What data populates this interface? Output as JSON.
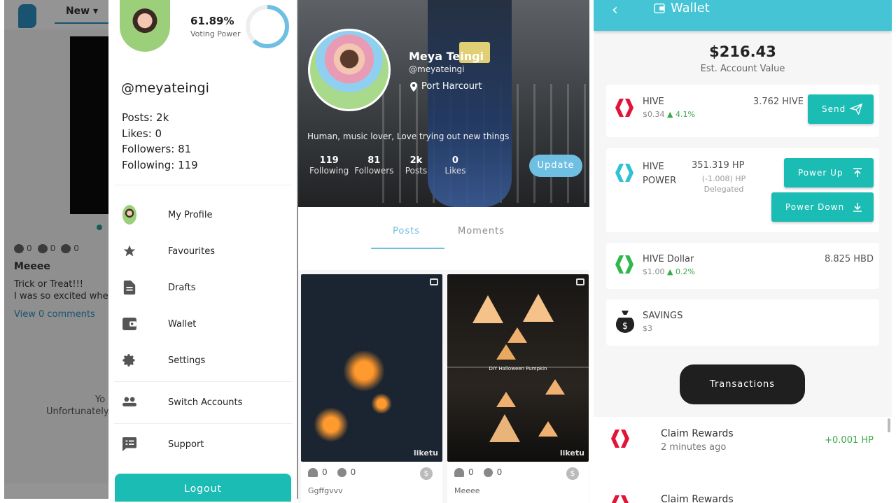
{
  "feed": {
    "tab_new": "New",
    "likes": "0",
    "comments": "0",
    "votes": "0",
    "post_title": "Meeee",
    "post_body_line1": "Trick or Treat!!!",
    "post_body_line2": "I was so excited whe",
    "view_comments": "View 0 comments",
    "empty_line1": "Yo",
    "empty_line2": "Unfortunately"
  },
  "drawer": {
    "voting_power_pct": "61.89%",
    "voting_power_value": 0.6189,
    "voting_power_label": "Voting Power",
    "handle": "@meyateingi",
    "posts": "Posts: 2k",
    "likes": "Likes: 0",
    "followers": "Followers: 81",
    "following": "Following: 119",
    "menu": {
      "my_profile": "My Profile",
      "favourites": "Favourites",
      "drafts": "Drafts",
      "wallet": "Wallet",
      "settings": "Settings",
      "switch_accounts": "Switch Accounts",
      "support": "Support"
    },
    "logout": "Logout"
  },
  "profile": {
    "name": "Meya Teingi",
    "handle": "@meyateingi",
    "location": "Port Harcourt",
    "bio": "Human, music lover, Love trying out new things",
    "stats": [
      {
        "n": "119",
        "l": "Following"
      },
      {
        "n": "81",
        "l": "Followers"
      },
      {
        "n": "2k",
        "l": "Posts"
      },
      {
        "n": "0",
        "l": "Likes"
      }
    ],
    "update_label": "Update",
    "tab_posts": "Posts",
    "tab_moments": "Moments",
    "posts": [
      {
        "title": "Ggffgvvv",
        "likes": "0",
        "comments": "0",
        "watermark": "liketu"
      },
      {
        "title": "Meeee",
        "likes": "0",
        "comments": "0",
        "caption": "DIY Halloween Pumpkin",
        "watermark": "liketu"
      }
    ]
  },
  "wallet": {
    "title": "Wallet",
    "total_value": "$216.43",
    "total_label": "Est. Account Value",
    "hive": {
      "name": "HIVE",
      "price": "$0.34",
      "change": "4.1%",
      "amount": "3.762 HIVE",
      "send": "Send"
    },
    "hive_power": {
      "name_line1": "HIVE",
      "name_line2": "POWER",
      "amount": "351.319 HP",
      "delegated_line1": "(-1.008) HP",
      "delegated_line2": "Delegated",
      "power_up": "Power Up",
      "power_down": "Power Down"
    },
    "hbd": {
      "name": "HIVE Dollar",
      "price": "$1.00",
      "change": "0.2%",
      "amount": "8.825 HBD"
    },
    "savings": {
      "name": "SAVINGS",
      "value": "$3"
    },
    "transactions_label": "Transactions",
    "tx": [
      {
        "title": "Claim Rewards",
        "time": "2 minutes ago",
        "amount": "+0.001 HP"
      },
      {
        "title": "Claim Rewards"
      }
    ],
    "colors": {
      "accent": "#1bbcb4",
      "header": "#44c4d4",
      "hive_red": "#e31337",
      "hive_cyan": "#30c0d8",
      "hive_green": "#2eb84a"
    }
  }
}
